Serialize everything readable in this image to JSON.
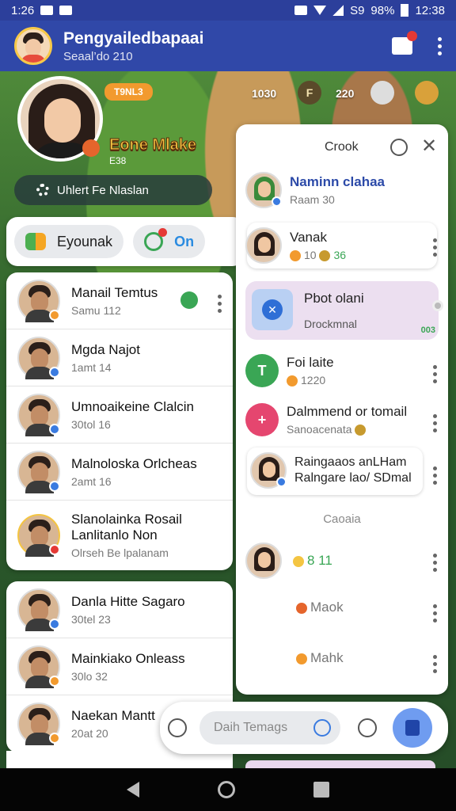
{
  "status_bar": {
    "time_left": "1:26",
    "signal_text": "S9",
    "battery": "98%",
    "time_right": "12:38"
  },
  "app_bar": {
    "title": "Pengyailedbapaai",
    "subtitle": "Seaal’do 210"
  },
  "game": {
    "badge": "T9NL3",
    "stat1": "1030",
    "chip_f": "F",
    "stat2": "220",
    "title": "Eone Mlake",
    "subtitle": "E38",
    "pill": "Uhlert Fe Nlaslan"
  },
  "tabs": [
    {
      "label": "Eyounak"
    },
    {
      "label": "On"
    }
  ],
  "contacts_top": [
    {
      "name": "Manail Temtus",
      "sub": "Samu 112",
      "tag_color": "#f29a2e"
    },
    {
      "name": "Mgda Najot",
      "sub": "1amt 14",
      "tag_color": "#3a7be0"
    },
    {
      "name": "Umnoaikeine Clalcin",
      "sub": "30tol 16",
      "tag_color": "#3a7be0"
    },
    {
      "name": "Malnoloska Orlcheas",
      "sub": "2amt 16",
      "tag_color": "#3a7be0"
    },
    {
      "name": "Slanolainka Rosail",
      "name2": "Lanlitanlo Non",
      "sub": "Olrseh Be lpalanam",
      "tag_color": "#e53935"
    }
  ],
  "contacts_bottom": [
    {
      "name": "Danla Hitte Sagaro",
      "sub": "30tel 23",
      "tag_color": "#3a7be0"
    },
    {
      "name": "Mainkiako Onleass",
      "sub": "30lo 32",
      "tag_color": "#f29a2e"
    },
    {
      "name": "Naekan Mantt",
      "sub": "20at 20",
      "tag_color": "#f29a2e"
    }
  ],
  "panel": {
    "title": "Crook",
    "user": {
      "name": "Naminn clahaa",
      "sub": "Raam 30"
    },
    "card": {
      "name": "Vanak",
      "stat1": "10",
      "stat2": "36"
    },
    "highlight": {
      "title": "Pbot olani",
      "sub": "Drockmnal",
      "meta": "003"
    },
    "items": [
      {
        "title": "Foi laite",
        "sub": "1220",
        "color": "#3aa655",
        "glyph": "T"
      },
      {
        "title": "Dalmmend or tomail",
        "sub": "Sanoacenata",
        "color": "#e5466f",
        "glyph": "+"
      },
      {
        "title": "Raingaaos anLHam",
        "sub": "Ralngare lao/ SDmal",
        "color": "",
        "glyph": ""
      }
    ],
    "section_label": "Caoaia",
    "lower": [
      {
        "label": "8 11"
      },
      {
        "label": "Maok"
      },
      {
        "label": "Mahk"
      }
    ]
  },
  "composer": {
    "placeholder": "Daih Temags"
  },
  "colors": {
    "status_bar": "#2c3f9b",
    "app_bar": "#3048a8",
    "accent_blue": "#3a7be0",
    "accent_green": "#3aa655",
    "accent_orange": "#f29a2e"
  }
}
